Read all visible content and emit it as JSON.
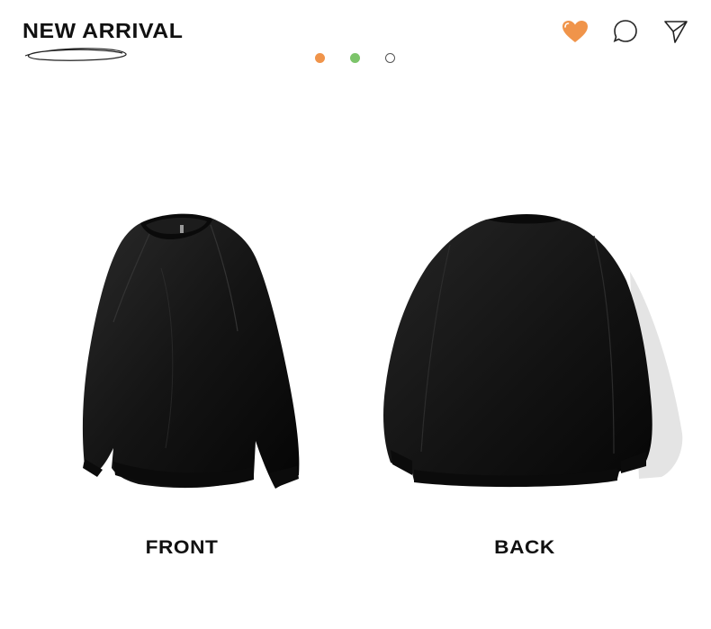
{
  "header": {
    "title": "NEW ARRIVAL"
  },
  "carousel": {
    "dots": [
      {
        "state": "filled",
        "color": "#f0944a"
      },
      {
        "state": "filled",
        "color": "#7cc46a"
      },
      {
        "state": "hollow",
        "color": "#ffffff"
      }
    ]
  },
  "actions": {
    "icons": [
      "heart-icon",
      "comment-icon",
      "share-icon"
    ],
    "heart_color": "#f0944a"
  },
  "views": {
    "front_label": "FRONT",
    "back_label": "BACK"
  },
  "colors": {
    "garment": "#141414",
    "text": "#111111"
  }
}
